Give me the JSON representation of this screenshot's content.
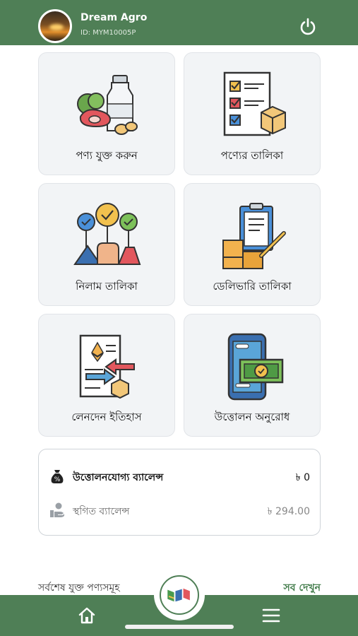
{
  "header": {
    "user_name": "Dream Agro",
    "user_id": "ID: MYM10005P",
    "avatar_icon": "sunset-avatar",
    "power_icon": "power-icon"
  },
  "tiles": [
    {
      "label": "পণ্য যুক্ত করুন",
      "icon": "groceries-icon"
    },
    {
      "label": "পণ্যের তালিকা",
      "icon": "checklist-box-icon"
    },
    {
      "label": "নিলাম তালিকা",
      "icon": "auction-vote-icon"
    },
    {
      "label": "ডেলিভারি তালিকা",
      "icon": "delivery-clipboard-icon"
    },
    {
      "label": "লেনদেন ইতিহাস",
      "icon": "transaction-history-icon"
    },
    {
      "label": "উত্তোলন অনুরোধ",
      "icon": "mobile-cash-icon"
    }
  ],
  "balance": {
    "withdrawable_label": "উত্তোলনযোগ্য ব্যালেন্স",
    "withdrawable_value": "৳ 0",
    "pending_label": "স্থগিত ব্যালেন্স",
    "pending_value": "৳ 294.00"
  },
  "recent": {
    "title": "সর্বশেষ যুক্ত পণ্যসমূহ",
    "see_all": "সব দেখুন"
  },
  "colors": {
    "brand_green": "#4f7f56",
    "link_green": "#3f7a48"
  },
  "bottom_nav": {
    "home_icon": "home-icon",
    "center_icon": "app-logo-icon",
    "menu_icon": "hamburger-menu-icon"
  }
}
